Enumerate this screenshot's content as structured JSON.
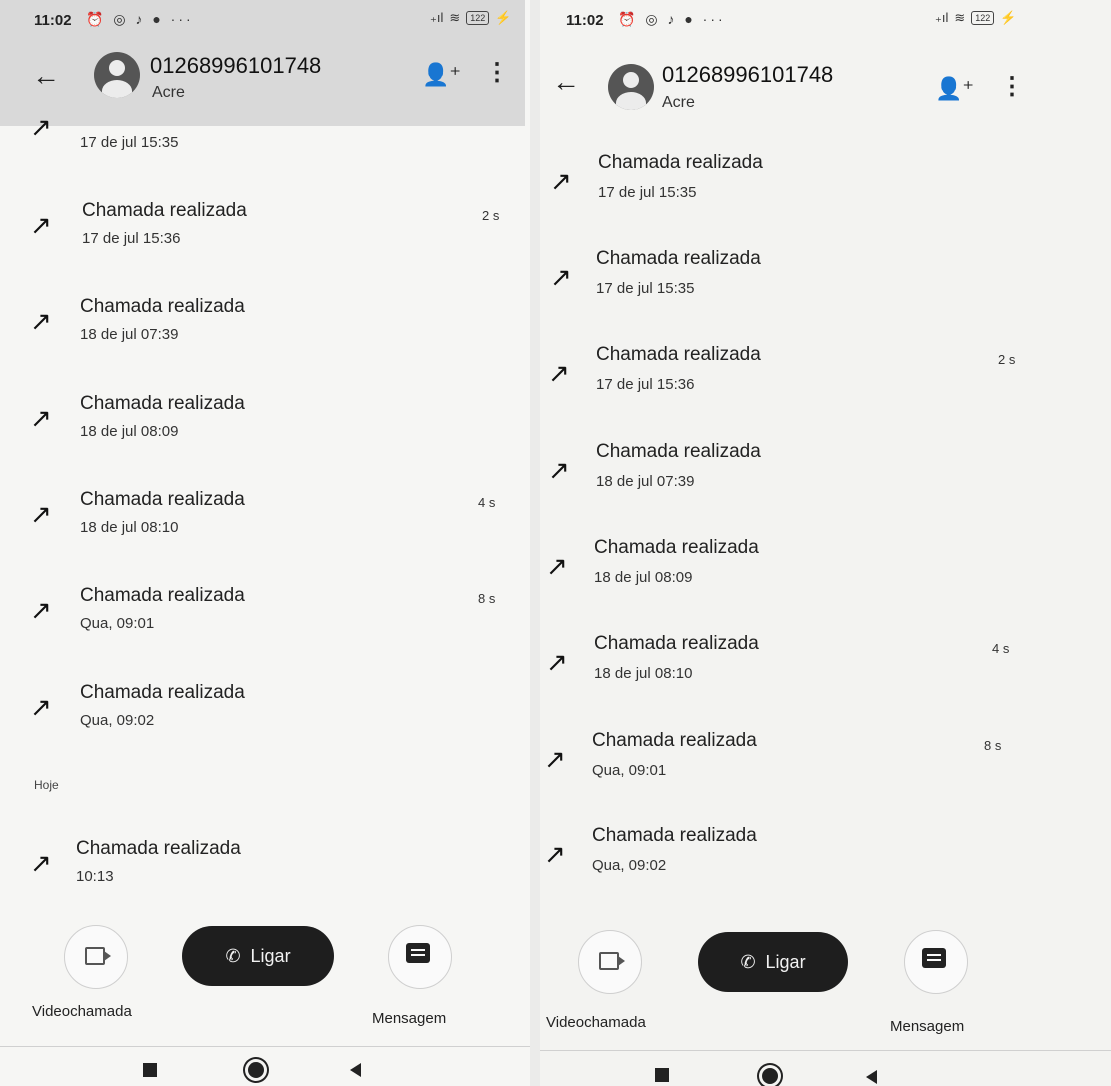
{
  "left": {
    "status": {
      "time": "11:02",
      "icons": "⏰ ◎ ♪ ● ···",
      "signal": "₊ıl",
      "wifi": "≋",
      "battery": "122"
    },
    "contact": {
      "number": "01268996101748",
      "subtitle": "Acre"
    },
    "entries": [
      {
        "title": "",
        "date": "17 de jul 15:35",
        "duration": ""
      },
      {
        "title": "Chamada realizada",
        "date": "17 de jul 15:36",
        "duration": "2 s"
      },
      {
        "title": "Chamada realizada",
        "date": "18 de jul 07:39",
        "duration": ""
      },
      {
        "title": "Chamada realizada",
        "date": "18 de jul 08:09",
        "duration": ""
      },
      {
        "title": "Chamada realizada",
        "date": "18 de jul 08:10",
        "duration": "4 s"
      },
      {
        "title": "Chamada realizada",
        "date": "Qua, 09:01",
        "duration": "8 s"
      },
      {
        "title": "Chamada realizada",
        "date": "Qua, 09:02",
        "duration": ""
      },
      {
        "title": "Chamada realizada",
        "date": "10:13",
        "duration": ""
      }
    ],
    "section_today": "Hoje",
    "actions": {
      "video": "Videochamada",
      "call": "Ligar",
      "message": "Mensagem"
    }
  },
  "right": {
    "status": {
      "time": "11:02",
      "icons": "⏰ ◎ ♪ ● ···",
      "signal": "₊ıl",
      "wifi": "≋",
      "battery": "122"
    },
    "contact": {
      "number": "01268996101748",
      "subtitle": "Acre"
    },
    "entries": [
      {
        "title": "Chamada realizada",
        "date": "17 de jul 15:35",
        "duration": ""
      },
      {
        "title": "Chamada realizada",
        "date": "17 de jul 15:35",
        "duration": ""
      },
      {
        "title": "Chamada realizada",
        "date": "17 de jul 15:36",
        "duration": "2 s"
      },
      {
        "title": "Chamada realizada",
        "date": "18 de jul 07:39",
        "duration": ""
      },
      {
        "title": "Chamada realizada",
        "date": "18 de jul 08:09",
        "duration": ""
      },
      {
        "title": "Chamada realizada",
        "date": "18 de jul 08:10",
        "duration": "4 s"
      },
      {
        "title": "Chamada realizada",
        "date": "Qua, 09:01",
        "duration": "8 s"
      },
      {
        "title": "Chamada realizada",
        "date": "Qua, 09:02",
        "duration": ""
      }
    ],
    "actions": {
      "video": "Videochamada",
      "call": "Ligar",
      "message": "Mensagem"
    }
  },
  "icons": {
    "back": "arrow-left-icon",
    "add_contact": "person-add-icon",
    "more": "more-vert-icon",
    "outgoing": "outgoing-call-arrow-icon",
    "video": "videocam-icon",
    "phone": "phone-icon",
    "message": "message-icon"
  }
}
